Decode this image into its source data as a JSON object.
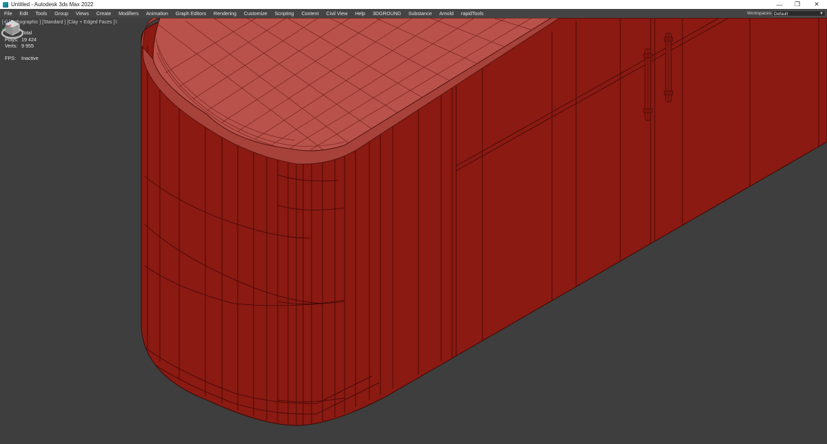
{
  "titlebar": {
    "title": "Untitled - Autodesk 3ds Max 2022",
    "minimize": "—",
    "restore": "❐",
    "close": "✕"
  },
  "menu": {
    "items": [
      "File",
      "Edit",
      "Tools",
      "Group",
      "Views",
      "Create",
      "Modifiers",
      "Animation",
      "Graph Editors",
      "Rendering",
      "Customize",
      "Scripting",
      "Content",
      "Civil View",
      "Help",
      "3DGROUND",
      "Substance",
      "Arnold",
      "rapidTools"
    ]
  },
  "workspace": {
    "label": "Workspaces:",
    "value": "Default"
  },
  "viewport": {
    "label": "[+] [Orthographic ] [Standard ] [Clay + Edged Faces ]",
    "filter_icon": "funnel-icon",
    "stats": {
      "header": "Total",
      "polys_label": "Polys:",
      "polys_value": "19 424",
      "verts_label": "Verts:",
      "verts_value": "9 955"
    },
    "fps_label": "FPS:",
    "fps_value": "Inactive"
  },
  "colors": {
    "background": "#3e3e3e",
    "clay_body": "#8a1a12",
    "clay_top": "#b5504a",
    "wire": "#3c0806",
    "menubar": "#444444"
  }
}
